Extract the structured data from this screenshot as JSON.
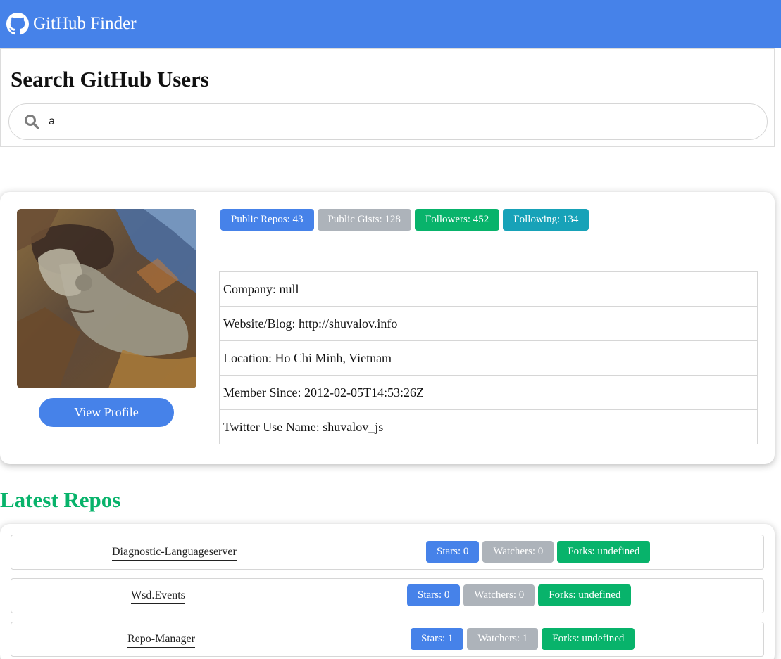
{
  "navbar": {
    "brand": "GitHub Finder",
    "icon": "github-icon"
  },
  "search": {
    "title": "Search GitHub Users",
    "value": "a",
    "icon": "search-icon"
  },
  "profile": {
    "view_profile_label": "View Profile",
    "badges": {
      "public_repos": "Public Repos: 43",
      "public_gists": "Public Gists: 128",
      "followers": "Followers: 452",
      "following": "Following: 134"
    },
    "details": {
      "company": "Company: null",
      "website": "Website/Blog: http://shuvalov.info",
      "location": "Location: Ho Chi Minh, Vietnam",
      "member_since": "Member Since: 2012-02-05T14:53:26Z",
      "twitter": "Twitter Use Name: shuvalov_js"
    }
  },
  "repos": {
    "title": "Latest Repos",
    "items": [
      {
        "name": "Diagnostic-Languageserver",
        "stars": "Stars: 0",
        "watchers": "Watchers: 0",
        "forks": "Forks: undefined"
      },
      {
        "name": "Wsd.Events",
        "stars": "Stars: 0",
        "watchers": "Watchers: 0",
        "forks": "Forks: undefined"
      },
      {
        "name": "Repo-Manager",
        "stars": "Stars: 1",
        "watchers": "Watchers: 1",
        "forks": "Forks: undefined"
      }
    ]
  },
  "colors": {
    "primary": "#4682e9",
    "success": "#08b36b",
    "secondary": "#adb3ba",
    "info": "#17a2b8"
  }
}
